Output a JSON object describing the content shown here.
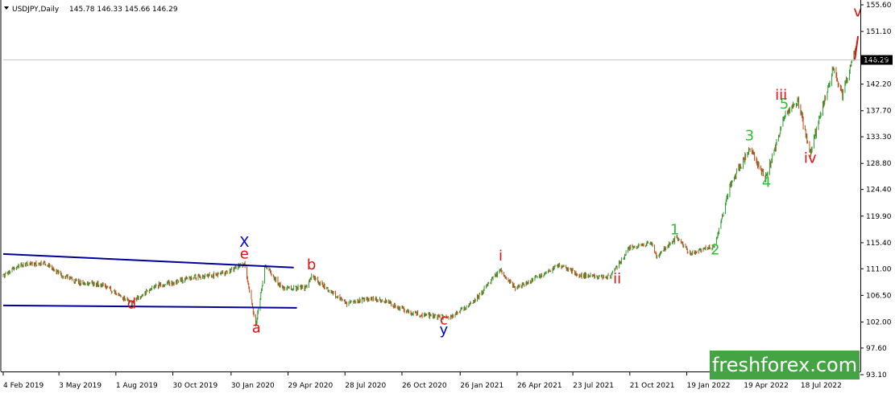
{
  "header": {
    "symbol": "USDJPY,Daily",
    "ohlc": "145.78 146.33 145.66 146.29"
  },
  "watermark": "freshforex.com",
  "colors": {
    "up_candle": "#2e9a2e",
    "down_candle": "#c24a17",
    "trendline": "#000099",
    "label_red": "#dd1111",
    "label_green": "#33bb33",
    "label_blue": "#0000cc",
    "watermark_bg": "#44a444",
    "last_price_bg": "#000000"
  },
  "chart_data": {
    "type": "candlestick",
    "instrument": "USDJPY",
    "timeframe": "Daily",
    "last_price": 146.29,
    "ylim": [
      93.1,
      155.6
    ],
    "y_ticks": [
      "155.60",
      "151.10",
      "146.60",
      "142.20",
      "137.70",
      "133.30",
      "128.80",
      "124.40",
      "119.90",
      "115.40",
      "111.00",
      "106.50",
      "102.00",
      "97.60",
      "93.10"
    ],
    "x_ticks": [
      "4 Feb 2019",
      "3 May 2019",
      "1 Aug 2019",
      "30 Oct 2019",
      "30 Jan 2020",
      "29 Apr 2020",
      "28 Jul 2020",
      "26 Oct 2020",
      "26 Jan 2021",
      "26 Apr 2021",
      "23 Jul 2021",
      "21 Oct 2021",
      "19 Jan 2022",
      "19 Apr 2022",
      "18 Jul 2022"
    ],
    "price_path": [
      [
        "2019-02-04",
        109.8
      ],
      [
        "2019-03-01",
        111.6
      ],
      [
        "2019-04-10",
        111.9
      ],
      [
        "2019-05-10",
        109.8
      ],
      [
        "2019-06-10",
        108.5
      ],
      [
        "2019-07-10",
        108.4
      ],
      [
        "2019-08-26",
        105.2
      ],
      [
        "2019-09-30",
        108.1
      ],
      [
        "2019-10-30",
        108.7
      ],
      [
        "2019-12-01",
        109.5
      ],
      [
        "2020-01-17",
        110.1
      ],
      [
        "2020-02-20",
        111.8
      ],
      [
        "2020-03-09",
        101.6
      ],
      [
        "2020-03-24",
        111.6
      ],
      [
        "2020-04-20",
        107.6
      ],
      [
        "2020-05-28",
        107.9
      ],
      [
        "2020-06-05",
        109.7
      ],
      [
        "2020-07-31",
        105.0
      ],
      [
        "2020-08-31",
        106.0
      ],
      [
        "2020-10-01",
        105.5
      ],
      [
        "2020-11-06",
        103.6
      ],
      [
        "2021-01-06",
        102.6
      ],
      [
        "2021-02-15",
        105.3
      ],
      [
        "2021-03-31",
        110.8
      ],
      [
        "2021-04-23",
        107.6
      ],
      [
        "2021-07-02",
        111.6
      ],
      [
        "2021-08-06",
        109.8
      ],
      [
        "2021-09-20",
        109.6
      ],
      [
        "2021-10-20",
        114.4
      ],
      [
        "2021-11-24",
        115.4
      ],
      [
        "2021-12-02",
        113.0
      ],
      [
        "2022-01-04",
        116.3
      ],
      [
        "2022-01-24",
        113.6
      ],
      [
        "2022-02-24",
        114.6
      ],
      [
        "2022-03-04",
        114.8
      ],
      [
        "2022-03-28",
        125.0
      ],
      [
        "2022-04-28",
        131.2
      ],
      [
        "2022-05-24",
        126.4
      ],
      [
        "2022-06-22",
        136.7
      ],
      [
        "2022-07-14",
        139.4
      ],
      [
        "2022-08-02",
        130.4
      ],
      [
        "2022-09-07",
        144.9
      ],
      [
        "2022-09-22",
        140.4
      ],
      [
        "2022-10-14",
        148.9
      ]
    ],
    "annotations": [
      {
        "text": "X",
        "date": "2020-02-20",
        "price": 114.7,
        "color": "blue"
      },
      {
        "text": "e",
        "date": "2020-02-20",
        "price": 112.7,
        "color": "red"
      },
      {
        "text": "a",
        "date": "2020-03-10",
        "price": 100.2,
        "color": "red"
      },
      {
        "text": "b",
        "date": "2020-06-05",
        "price": 110.9,
        "color": "red"
      },
      {
        "text": "d",
        "date": "2019-08-26",
        "price": 104.3,
        "color": "red"
      },
      {
        "text": "c",
        "date": "2020-12-31",
        "price": 101.6,
        "color": "red"
      },
      {
        "text": "y",
        "date": "2020-12-31",
        "price": 99.9,
        "color": "blue"
      },
      {
        "text": "i",
        "date": "2021-03-31",
        "price": 112.4,
        "color": "red"
      },
      {
        "text": "ii",
        "date": "2021-10-01",
        "price": 108.5,
        "color": "red"
      },
      {
        "text": "1",
        "date": "2021-12-31",
        "price": 116.8,
        "color": "green"
      },
      {
        "text": "2",
        "date": "2022-03-05",
        "price": 113.4,
        "color": "green"
      },
      {
        "text": "3",
        "date": "2022-04-28",
        "price": 132.7,
        "color": "green"
      },
      {
        "text": "4",
        "date": "2022-05-25",
        "price": 124.8,
        "color": "green"
      },
      {
        "text": "5",
        "date": "2022-06-22",
        "price": 138.1,
        "color": "green"
      },
      {
        "text": "iii",
        "date": "2022-06-17",
        "price": 139.6,
        "color": "red"
      },
      {
        "text": "iv",
        "date": "2022-08-02",
        "price": 128.9,
        "color": "red"
      },
      {
        "text": "v",
        "date": "2022-10-16",
        "price": 153.6,
        "color": "red"
      }
    ],
    "trendlines": [
      {
        "from": [
          "2019-02-04",
          113.5
        ],
        "to": [
          "2020-05-08",
          111.2
        ]
      },
      {
        "from": [
          "2019-02-04",
          104.8
        ],
        "to": [
          "2020-05-13",
          104.4
        ]
      }
    ],
    "horizontal_line": 146.29,
    "grid": false
  }
}
